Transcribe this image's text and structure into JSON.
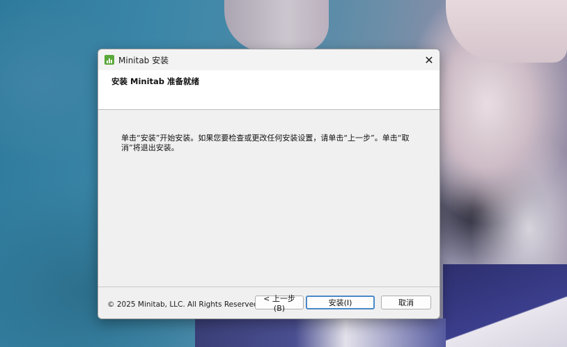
{
  "window": {
    "title": "Minitab 安装",
    "close_glyph": "✕"
  },
  "header": {
    "title": "安装 Minitab 准备就绪"
  },
  "content": {
    "message": "单击“安装”开始安装。如果您要检查或更改任何安装设置，请单击“上一步”。单击“取消”将退出安装。"
  },
  "footer": {
    "copyright": "© 2025 Minitab, LLC. All Rights Reserved.",
    "back_label": "< 上一步(B)",
    "install_label": "安装(I)",
    "cancel_label": "取消"
  },
  "icons": {
    "app": "minitab-logo-icon",
    "close": "close-icon"
  },
  "colors": {
    "app_icon": "#5aa83a",
    "default_button_border": "#4a88c8"
  }
}
